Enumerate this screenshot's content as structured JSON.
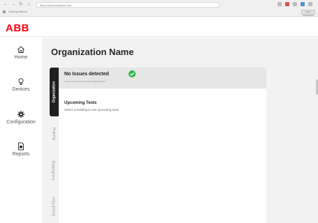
{
  "browser": {
    "url": "https://www.example.com",
    "tab_label": "Getting Started",
    "extension_label": "Other bookmarks"
  },
  "header": {
    "logo": "ABB"
  },
  "sidebar": {
    "items": [
      {
        "label": "Home",
        "icon": "home-icon"
      },
      {
        "label": "Devices",
        "icon": "lightbulb-icon"
      },
      {
        "label": "Configuration",
        "icon": "gear-icon"
      },
      {
        "label": "Reports",
        "icon": "document-icon"
      }
    ]
  },
  "main": {
    "title": "Organization Name",
    "tabs": [
      {
        "label": "Organization",
        "active": true
      },
      {
        "label": "Building",
        "active": false
      },
      {
        "label": "Sub-Building",
        "active": false
      },
      {
        "label": "Default Floor",
        "active": false
      }
    ],
    "status": {
      "title": "No Issues detected",
      "subtitle": "Last scanned on this organization",
      "icon": "check-circle-icon",
      "color": "#2fb34a"
    },
    "tests": {
      "title": "Upcoming Tests",
      "subtitle": "Select a building to see upcoming tests"
    }
  },
  "colors": {
    "brand": "#ff000f",
    "active_tab": "#1f1f1f",
    "ok": "#2fb34a"
  }
}
